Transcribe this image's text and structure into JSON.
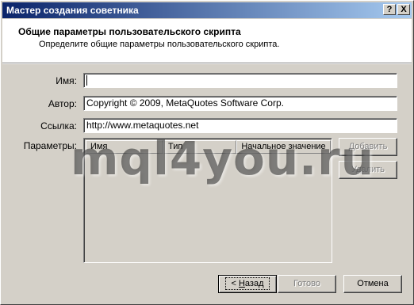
{
  "window": {
    "title": "Мастер создания советника",
    "help_label": "?",
    "close_label": "X"
  },
  "header": {
    "title": "Общие параметры пользовательского скрипта",
    "subtitle": "Определите общие параметры пользовательского скрипта."
  },
  "form": {
    "name_label": "Имя:",
    "name_value": "",
    "author_label": "Автор:",
    "author_value": "Copyright © 2009, MetaQuotes Software Corp.",
    "link_label": "Ссылка:",
    "link_value": "http://www.metaquotes.net",
    "params_label": "Параметры:"
  },
  "params_table": {
    "columns": [
      "Имя",
      "Тип",
      "Начальное значение"
    ],
    "rows": []
  },
  "buttons": {
    "add": "Добавить",
    "delete": "Удалить",
    "back_prefix": "< ",
    "back_accel": "Н",
    "back_rest": "азад",
    "next": "Готово",
    "cancel": "Отмена"
  },
  "watermark": "mql4you.ru"
}
